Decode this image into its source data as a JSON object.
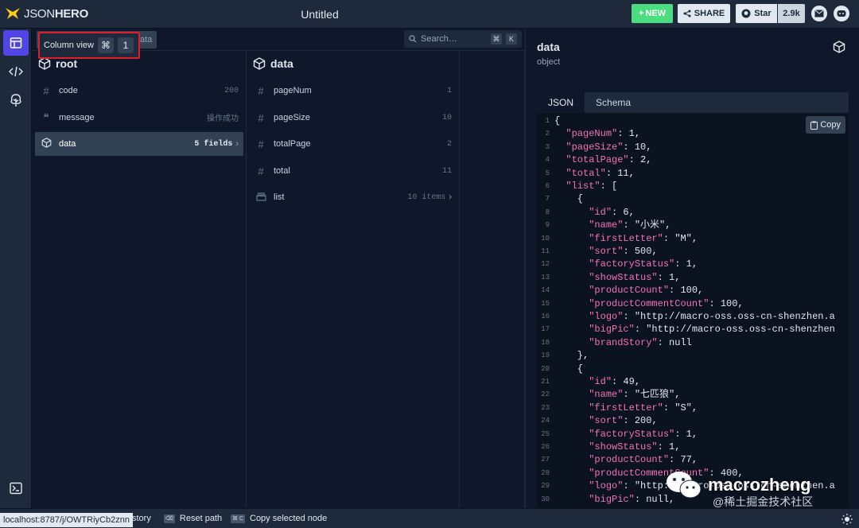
{
  "header": {
    "logo_json": "JSON",
    "logo_hero": "HERO",
    "title": "Untitled",
    "new_label": "NEW",
    "share_label": "SHARE",
    "star_label": "Star",
    "star_count": "2.9k"
  },
  "tooltip": {
    "label": "Column view",
    "kbd_cmd": "⌘",
    "kbd_key": "1"
  },
  "toolbar": {
    "path_fragment": "ata",
    "search_placeholder": "Search…",
    "search_kbd_cmd": "⌘",
    "search_kbd_key": "K"
  },
  "columns": [
    {
      "title": "root",
      "rows": [
        {
          "icon": "#",
          "key": "code",
          "value": "200"
        },
        {
          "icon": "❝",
          "key": "message",
          "value": "操作成功"
        },
        {
          "icon": "cube",
          "key": "data",
          "value": "5 fields",
          "selected": true
        }
      ]
    },
    {
      "title": "data",
      "rows": [
        {
          "icon": "#",
          "key": "pageNum",
          "value": "1"
        },
        {
          "icon": "#",
          "key": "pageSize",
          "value": "10"
        },
        {
          "icon": "#",
          "key": "totalPage",
          "value": "2"
        },
        {
          "icon": "#",
          "key": "total",
          "value": "11"
        },
        {
          "icon": "list",
          "key": "list",
          "value": "10 items"
        }
      ]
    }
  ],
  "panel": {
    "title": "data",
    "subtitle": "object",
    "tabs": [
      "JSON",
      "Schema"
    ],
    "copy_label": "Copy",
    "code_lines": [
      "{",
      "  \"pageNum\": 1,",
      "  \"pageSize\": 10,",
      "  \"totalPage\": 2,",
      "  \"total\": 11,",
      "  \"list\": [",
      "    {",
      "      \"id\": 6,",
      "      \"name\": \"小米\",",
      "      \"firstLetter\": \"M\",",
      "      \"sort\": 500,",
      "      \"factoryStatus\": 1,",
      "      \"showStatus\": 1,",
      "      \"productCount\": 100,",
      "      \"productCommentCount\": 100,",
      "      \"logo\": \"http://macro-oss.oss-cn-shenzhen.a",
      "      \"bigPic\": \"http://macro-oss.oss-cn-shenzhen",
      "      \"brandStory\": null",
      "    },",
      "    {",
      "      \"id\": 49,",
      "      \"name\": \"七匹狼\",",
      "      \"firstLetter\": \"S\",",
      "      \"sort\": 200,",
      "      \"factoryStatus\": 1,",
      "      \"showStatus\": 1,",
      "      \"productCount\": 77,",
      "      \"productCommentCount\": 400,",
      "      \"logo\": \"http://macro-oss.oss-cn-shenzhen.a",
      "      \"bigPic\": null,"
    ]
  },
  "watermark": {
    "name": "macrozheng",
    "sub": "@稀土掘金技术社区"
  },
  "footer": {
    "url": "localhost:8787/j/OWTRiyCb2znn",
    "history_label": "story",
    "reset_kbd": "⌫",
    "reset_label": "Reset path",
    "copy_kbd": "⌘ C",
    "copy_label": "Copy selected node"
  },
  "colors": {
    "accent": "#4f46e5",
    "new_btn": "#4ade80",
    "highlight": "#e11d2a"
  }
}
